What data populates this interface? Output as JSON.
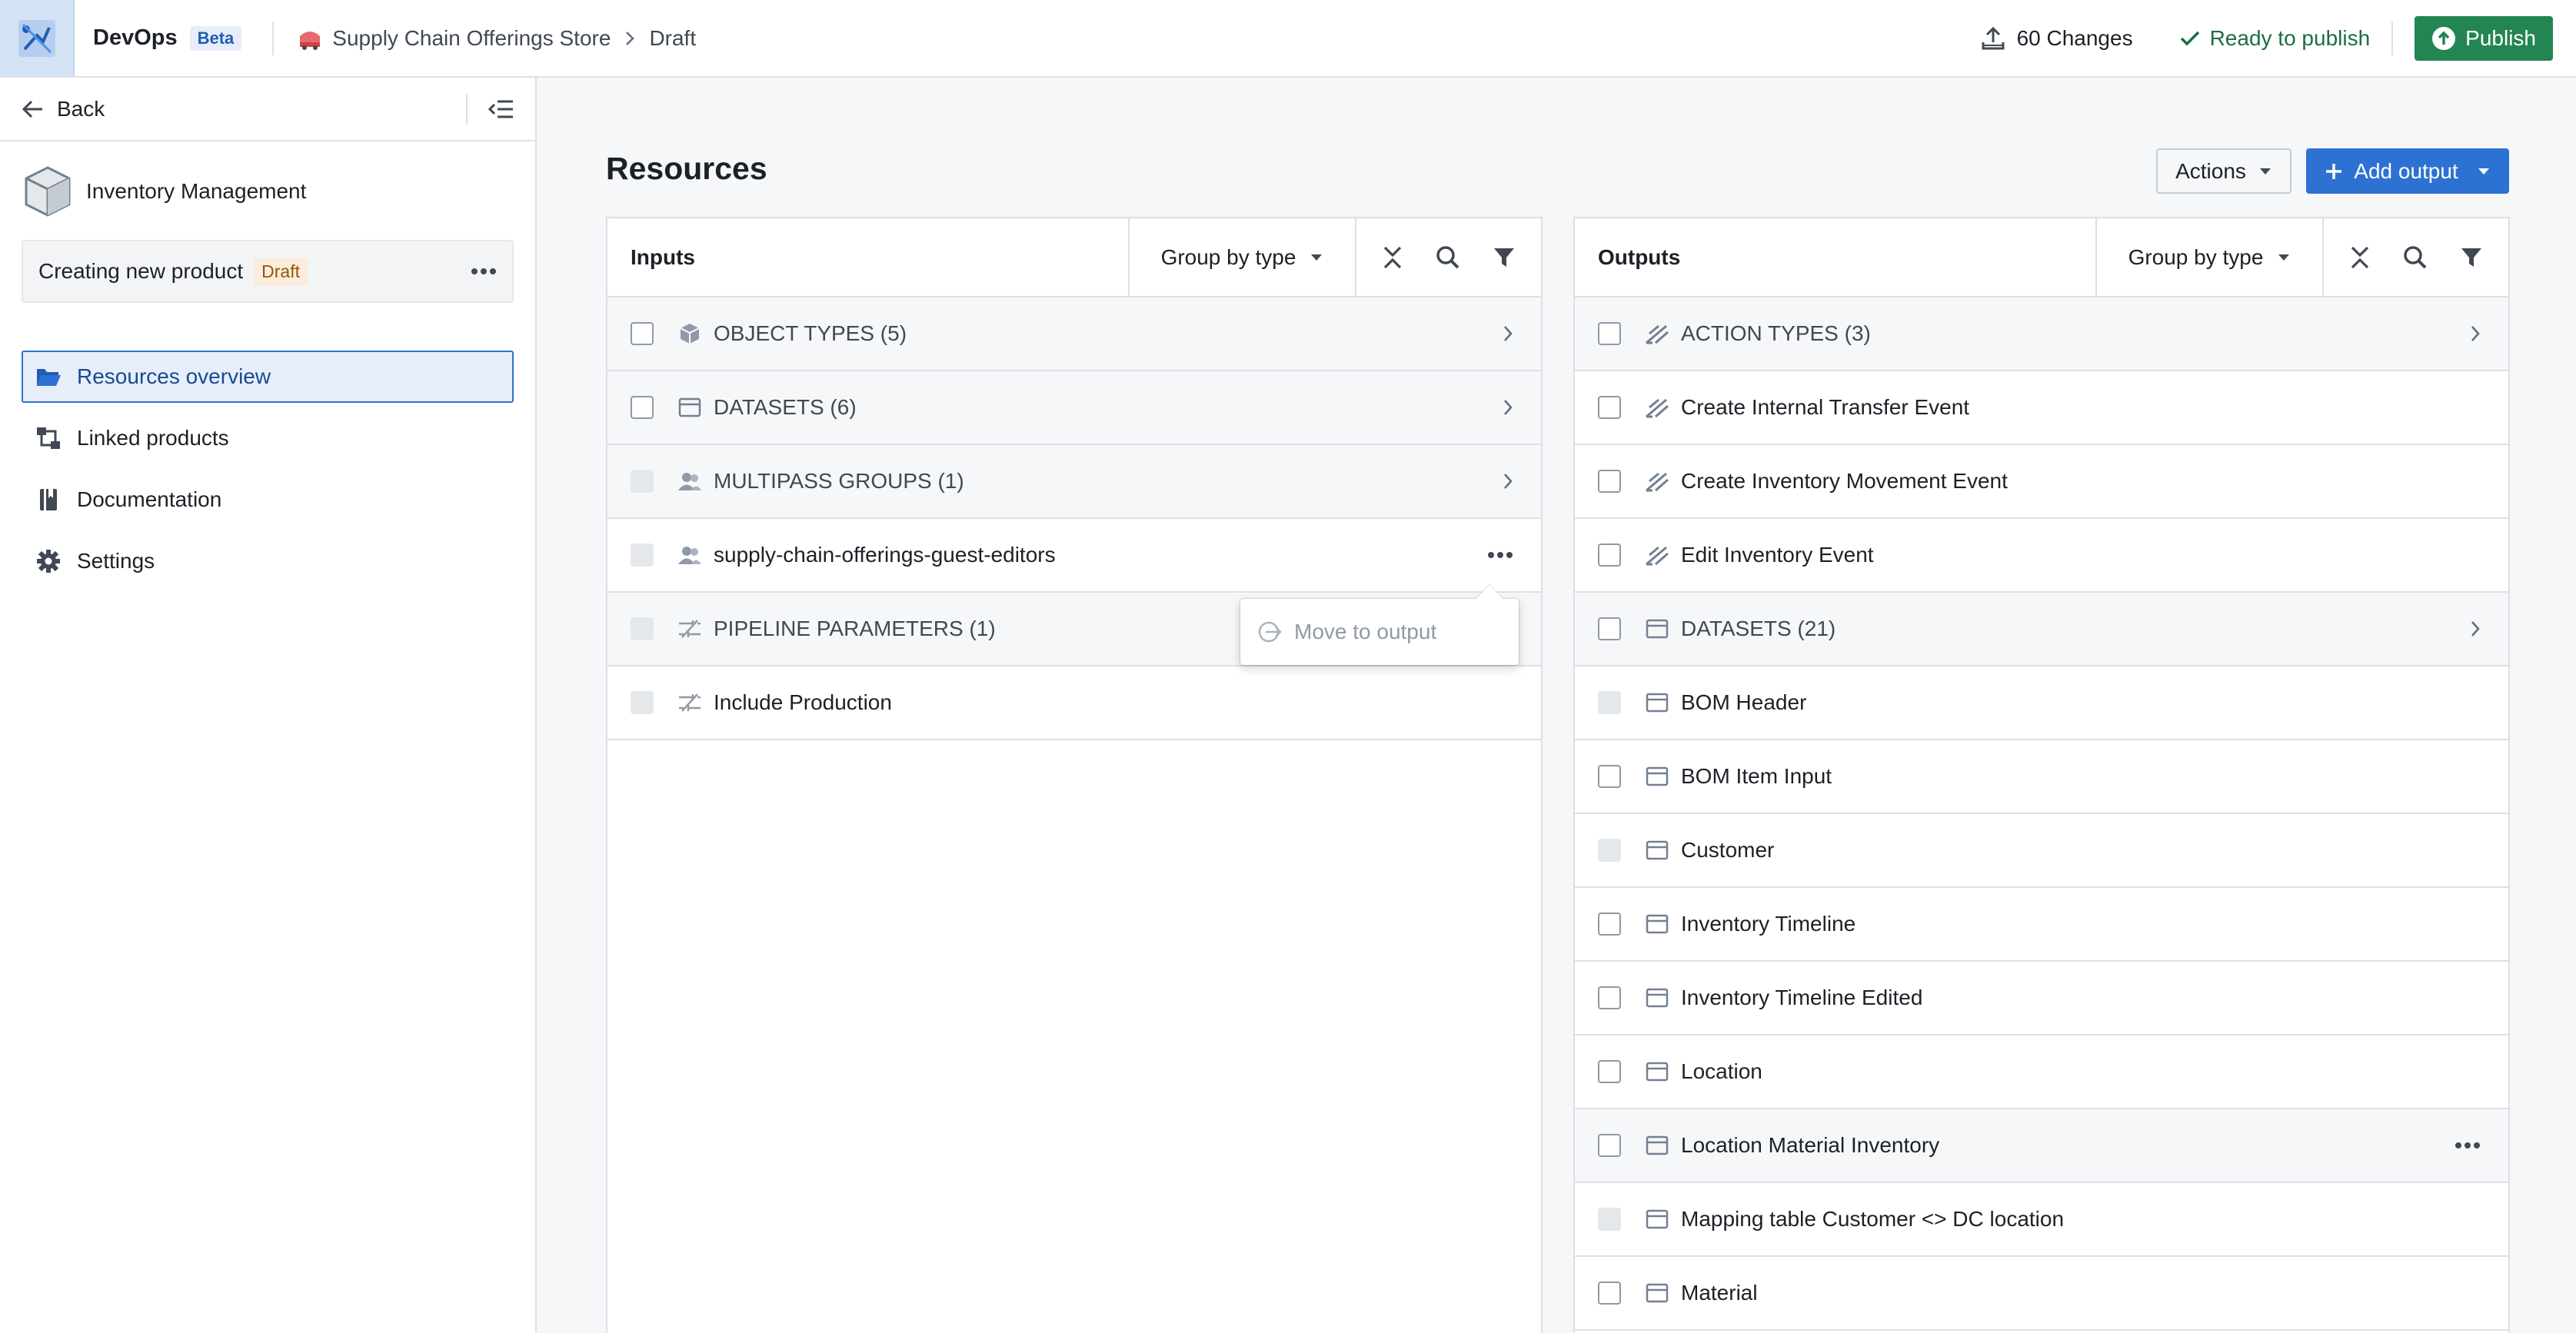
{
  "app": {
    "name": "DevOps",
    "badge": "Beta"
  },
  "breadcrumb": {
    "store": "Supply Chain Offerings Store",
    "current": "Draft"
  },
  "header": {
    "changes": "60 Changes",
    "status": "Ready to publish",
    "publish": "Publish"
  },
  "sidebar": {
    "back": "Back",
    "product": "Inventory Management",
    "branch": {
      "name": "Creating new product",
      "tag": "Draft"
    },
    "nav": [
      {
        "label": "Resources overview"
      },
      {
        "label": "Linked products"
      },
      {
        "label": "Documentation"
      },
      {
        "label": "Settings"
      }
    ]
  },
  "main": {
    "title": "Resources",
    "actions": "Actions",
    "add_output": "Add output"
  },
  "inputs": {
    "title": "Inputs",
    "group_by": "Group by type",
    "rows": [
      {
        "label": "OBJECT TYPES (5)"
      },
      {
        "label": "DATASETS (6)"
      },
      {
        "label": "MULTIPASS GROUPS (1)"
      },
      {
        "label": "supply-chain-offerings-guest-editors"
      },
      {
        "label": "PIPELINE PARAMETERS (1)"
      },
      {
        "label": "Include Production"
      }
    ],
    "menu_item": "Move to output"
  },
  "outputs": {
    "title": "Outputs",
    "group_by": "Group by type",
    "rows": [
      {
        "label": "ACTION TYPES (3)"
      },
      {
        "label": "Create Internal Transfer Event"
      },
      {
        "label": "Create Inventory Movement Event"
      },
      {
        "label": "Edit Inventory Event"
      },
      {
        "label": "DATASETS (21)"
      },
      {
        "label": "BOM Header"
      },
      {
        "label": "BOM Item Input"
      },
      {
        "label": "Customer"
      },
      {
        "label": "Inventory Timeline"
      },
      {
        "label": "Inventory Timeline Edited"
      },
      {
        "label": "Location"
      },
      {
        "label": "Location Material Inventory"
      },
      {
        "label": "Mapping table Customer <> DC location"
      },
      {
        "label": "Material"
      }
    ]
  },
  "colors": {
    "accent": "#2d72d2",
    "publish": "#238551",
    "ready": "#1c6e42",
    "draft_tag_bg": "#fbecdb"
  }
}
